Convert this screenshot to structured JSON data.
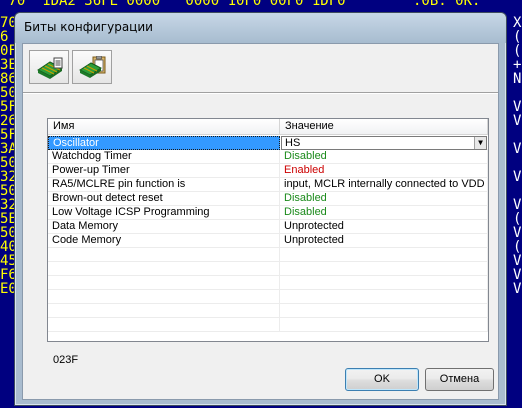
{
  "background": {
    "top_line": " 70  1DA2 36FE 0000   0000 10F0 00F0 1DF0        .0B.'0K.",
    "left_chars": [
      "70",
      "6",
      "0F",
      "3E",
      "86",
      "50",
      "5F",
      "26",
      "5F",
      "3A",
      "50",
      "32",
      "50",
      "32",
      "5E",
      "50",
      "40",
      "45",
      "F6",
      "E0"
    ],
    "right_chars": [
      "X",
      "(",
      "(",
      "+",
      "N",
      "",
      "V",
      "V",
      "",
      "V",
      "",
      "V",
      "",
      "V",
      "(",
      "V",
      "(",
      "V",
      "V",
      "V"
    ]
  },
  "window": {
    "title": "Биты конфигурации"
  },
  "toolbar": {
    "buttons": [
      {
        "icon": "chip-board-icon"
      },
      {
        "icon": "chip-clipboard-icon"
      }
    ]
  },
  "grid": {
    "columns": [
      "Имя",
      "Значение"
    ],
    "rows": [
      {
        "name": "Oscillator",
        "value": "HS",
        "color": "#000000"
      },
      {
        "name": "Watchdog Timer",
        "value": "Disabled",
        "color": "#1b8a1b"
      },
      {
        "name": "Power-up Timer",
        "value": "Enabled",
        "color": "#cc0000"
      },
      {
        "name": "RA5/MCLRE pin function is",
        "value": "input, MCLR internally connected to VDD",
        "color": "#000000"
      },
      {
        "name": "Brown-out detect reset",
        "value": "Disabled",
        "color": "#1b8a1b"
      },
      {
        "name": "Low Voltage ICSP Programming",
        "value": "Disabled",
        "color": "#1b8a1b"
      },
      {
        "name": "Data Memory",
        "value": "Unprotected",
        "color": "#000000"
      },
      {
        "name": "Code Memory",
        "value": "Unprotected",
        "color": "#000000"
      }
    ]
  },
  "status_value": "023F",
  "buttons": {
    "ok": "OK",
    "cancel": "Отмена"
  }
}
